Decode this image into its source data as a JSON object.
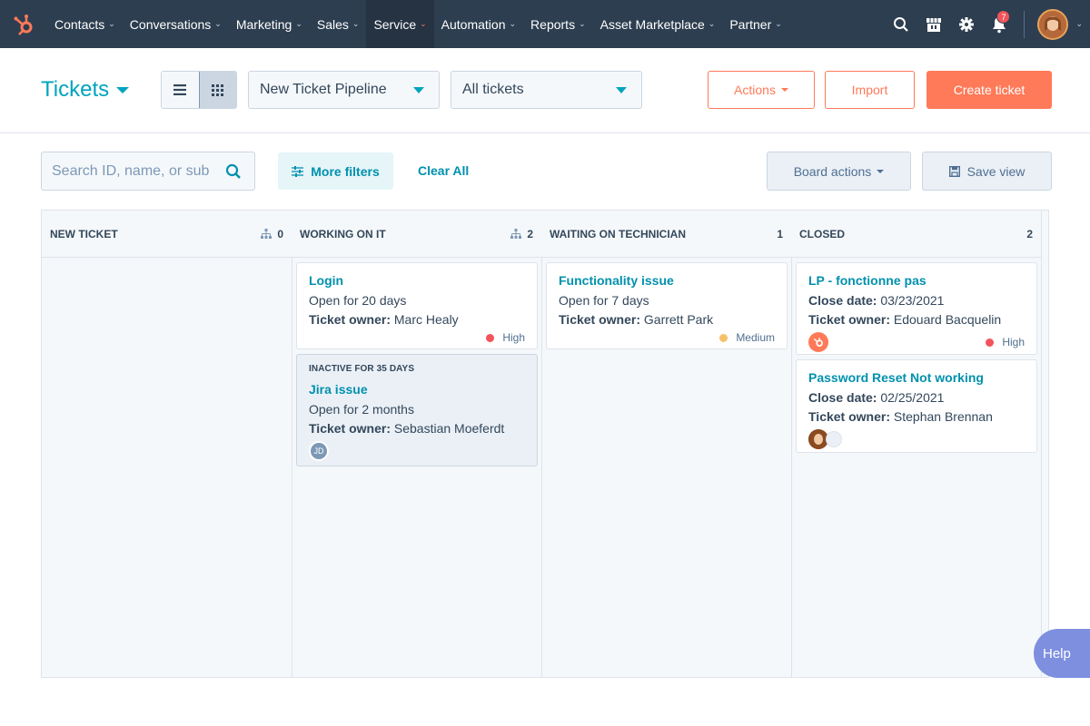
{
  "nav": {
    "items": [
      {
        "label": "Contacts"
      },
      {
        "label": "Conversations"
      },
      {
        "label": "Marketing"
      },
      {
        "label": "Sales"
      },
      {
        "label": "Service"
      },
      {
        "label": "Automation"
      },
      {
        "label": "Reports"
      },
      {
        "label": "Asset Marketplace"
      },
      {
        "label": "Partner"
      }
    ],
    "active": "Service",
    "notification_count": "7"
  },
  "header": {
    "title": "Tickets",
    "pipeline": "New Ticket Pipeline",
    "view": "All tickets",
    "actions_label": "Actions",
    "import_label": "Import",
    "create_label": "Create ticket"
  },
  "filters": {
    "search_placeholder": "Search ID, name, or sub",
    "more_filters": "More filters",
    "clear_all": "Clear All",
    "board_actions": "Board actions",
    "save_view": "Save view"
  },
  "board": {
    "columns": [
      {
        "title": "NEW TICKET",
        "count": "0"
      },
      {
        "title": "WORKING ON IT",
        "count": "2"
      },
      {
        "title": "WAITING ON TECHNICIAN",
        "count": "1"
      },
      {
        "title": "CLOSED",
        "count": "2"
      }
    ],
    "cards": {
      "login": {
        "title": "Login",
        "line1": "Open for 20 days",
        "owner_label": "Ticket owner:",
        "owner": "Marc Healy",
        "priority": "High"
      },
      "jira": {
        "inactive": "INACTIVE FOR 35 DAYS",
        "title": "Jira issue",
        "line1": "Open for 2 months",
        "owner_label": "Ticket owner:",
        "owner": "Sebastian Moeferdt",
        "initials": "JD"
      },
      "functionality": {
        "title": "Functionality issue",
        "line1": "Open for 7 days",
        "owner_label": "Ticket owner:",
        "owner": "Garrett Park",
        "priority": "Medium"
      },
      "lp": {
        "title": "LP - fonctionne pas",
        "date_label": "Close date:",
        "date": "03/23/2021",
        "owner_label": "Ticket owner:",
        "owner": "Edouard Bacquelin",
        "priority": "High"
      },
      "password": {
        "title": "Password Reset Not working",
        "date_label": "Close date:",
        "date": "02/25/2021",
        "owner_label": "Ticket owner:",
        "owner": "Stephan Brennan"
      }
    }
  },
  "help_label": "Help",
  "colors": {
    "nav_bg": "#2d3e50",
    "accent": "#ff7a59",
    "link": "#0091ae",
    "high": "#f2545b",
    "medium": "#f5c26b"
  }
}
